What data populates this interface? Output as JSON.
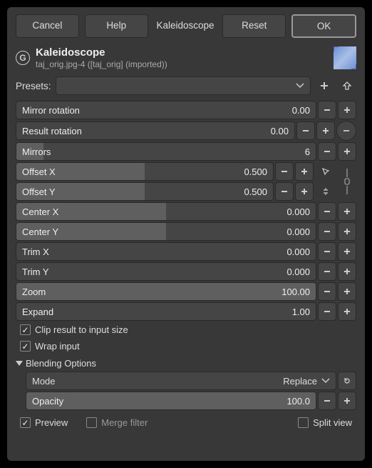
{
  "buttons": {
    "cancel": "Cancel",
    "help": "Help",
    "kaleidoscope": "Kaleidoscope",
    "reset": "Reset",
    "ok": "OK"
  },
  "header": {
    "title": "Kaleidoscope",
    "subtitle": "taj_orig.jpg-4 ([taj_orig] (imported))"
  },
  "presets": {
    "label": "Presets:"
  },
  "params": {
    "mirror_rotation": {
      "label": "Mirror rotation",
      "value": "0.00",
      "fill_pct": 0
    },
    "result_rotation": {
      "label": "Result rotation",
      "value": "0.00",
      "fill_pct": 0
    },
    "mirrors": {
      "label": "Mirrors",
      "value": "6",
      "fill_pct": 9
    },
    "offset_x": {
      "label": "Offset X",
      "value": "0.500",
      "fill_pct": 50
    },
    "offset_y": {
      "label": "Offset Y",
      "value": "0.500",
      "fill_pct": 50
    },
    "center_x": {
      "label": "Center X",
      "value": "0.000",
      "fill_pct": 50
    },
    "center_y": {
      "label": "Center Y",
      "value": "0.000",
      "fill_pct": 50
    },
    "trim_x": {
      "label": "Trim X",
      "value": "0.000",
      "fill_pct": 0
    },
    "trim_y": {
      "label": "Trim Y",
      "value": "0.000",
      "fill_pct": 0
    },
    "zoom": {
      "label": "Zoom",
      "value": "100.00",
      "fill_pct": 100
    },
    "expand": {
      "label": "Expand",
      "value": "1.00",
      "fill_pct": 0
    }
  },
  "checkboxes": {
    "clip": "Clip result to input size",
    "wrap": "Wrap input"
  },
  "blending": {
    "heading": "Blending Options",
    "mode_label": "Mode",
    "mode_value": "Replace",
    "opacity_label": "Opacity",
    "opacity_value": "100.0"
  },
  "footer": {
    "preview": "Preview",
    "merge": "Merge filter",
    "split": "Split view"
  }
}
